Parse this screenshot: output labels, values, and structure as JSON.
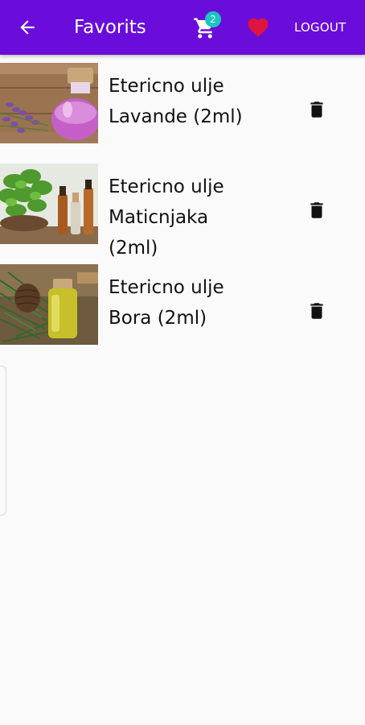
{
  "header": {
    "title": "Favorits",
    "back_icon": "arrow-left-icon",
    "cart_icon": "shopping-cart-icon",
    "cart_count": "2",
    "favorites_icon": "heart-icon",
    "logout_label": "LOGOUT"
  },
  "favorites": [
    {
      "name": "Etericno ulje Lavande (2ml)",
      "image": "lavender-oil-photo"
    },
    {
      "name": "Etericno ulje Maticnjaka (2ml)",
      "image": "lemon-balm-oil-photo"
    },
    {
      "name": "Etericno ulje Bora (2ml)",
      "image": "pine-oil-photo"
    }
  ],
  "colors": {
    "app_bar": "#6a0ddb",
    "badge": "#19c6c2",
    "heart": "#e0143c",
    "background": "#fafafa"
  }
}
